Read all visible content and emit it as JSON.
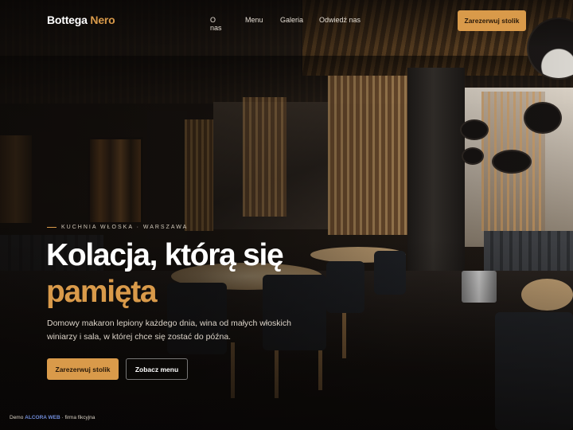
{
  "brand": {
    "part1": "Bottega",
    "part2": "Nero"
  },
  "nav": {
    "links": [
      "O nas",
      "Menu",
      "Galeria",
      "Odwiedź nas"
    ],
    "cta": "Zarezerwuj stolik"
  },
  "hero": {
    "eyebrow": "KUCHNIA WŁOSKA · WARSZAWA",
    "headline_line1": "Kolacja, którą się",
    "headline_line2": "pamięta",
    "lead": "Domowy makaron lepiony każdego dnia, wina od małych włoskich winiarzy i sala, w której chce się zostać do późna.",
    "primary_button": "Zarezerwuj stolik",
    "secondary_button": "Zobacz menu"
  },
  "footer": {
    "prefix": "Demo",
    "agency": "ALCORA WEB",
    "suffix": "· firma fikcyjna"
  },
  "colors": {
    "accent": "#d99a4a",
    "text": "#ffffff",
    "background": "#0d0a08",
    "agency_link": "#6f8bd8"
  }
}
